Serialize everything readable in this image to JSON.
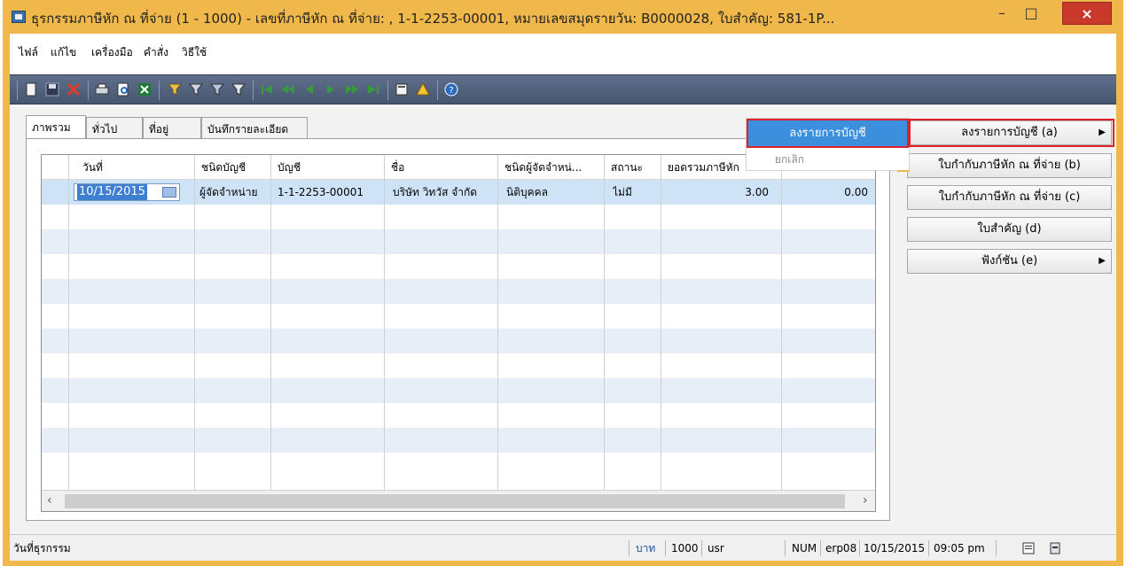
{
  "window": {
    "title": "ธุรกรรมภาษีหัก ณ ที่จ่าย (1 - 1000) - เลขที่ภาษีหัก ณ ที่จ่าย: , 1-1-2253-00001, หมายเลขสมุดรายวัน: B0000028, ใบสำคัญ: 581-1P...",
    "min_label": "–",
    "max_label": "□",
    "close_label": "×"
  },
  "menu": [
    "ไฟล์",
    "แก้ไข",
    "เครื่องมือ",
    "คำสั่ง",
    "วิธีใช้"
  ],
  "tabs": [
    "ภาพรวม",
    "ทั่วไป",
    "ที่อยู่",
    "บันทึกรายละเอียด"
  ],
  "grid": {
    "columns": [
      "วันที่",
      "ชนิดบัญชี",
      "บัญชี",
      "ชื่อ",
      "ชนิดผู้จัดจำหน่...",
      "สถานะ",
      "ยอดรวมภาษีหัก"
    ],
    "row": {
      "date": "10/15/2015",
      "account_type": "ผู้จัดจำหน่าย",
      "account": "1-1-2253-00001",
      "name": "บริษัท วิทวัส จำกัด",
      "vendor_type": "นิติบุคคล",
      "status": "ไม่มี",
      "total_tax": "3.00",
      "extra": "0.00"
    }
  },
  "popup": {
    "highlighted": "ลงรายการบัญชี",
    "cancel": "ยกเลิก"
  },
  "right_buttons": [
    "ลงรายการบัญชี (a)",
    "ใบกำกับภาษีหัก ณ ที่จ่าย (b)",
    "ใบกำกับภาษีหัก ณ ที่จ่าย (c)",
    "ใบสำคัญ (d)",
    "ฟังก์ชัน (e)"
  ],
  "status": {
    "left": "วันที่ธุรกรรม",
    "currency": "บาท",
    "company": "1000",
    "user": "usr",
    "num": "NUM",
    "server": "erp08",
    "date": "10/15/2015",
    "time": "09:05 pm"
  },
  "colors": {
    "title_accent": "#f0b84a",
    "toolbar": "#4f5e78",
    "selection": "#3c8fdc",
    "highlight_frame": "#e0202a"
  },
  "icons": [
    "new-icon",
    "save-icon",
    "delete-icon",
    "print-icon",
    "print-preview-icon",
    "excel-icon",
    "filter-icon",
    "filter-by-field-icon",
    "filter-by-selection-icon",
    "remove-filter-icon",
    "first-record-icon",
    "previous-page-icon",
    "previous-record-icon",
    "next-record-icon",
    "next-page-icon",
    "last-record-icon",
    "attachment-icon",
    "alert-icon",
    "help-icon"
  ]
}
